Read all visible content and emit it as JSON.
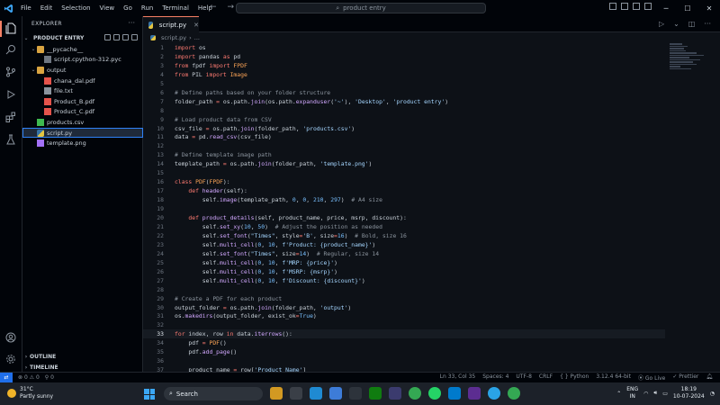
{
  "menu": [
    "File",
    "Edit",
    "Selection",
    "View",
    "Go",
    "Run",
    "Terminal",
    "Help"
  ],
  "search": {
    "placeholder": "product entry"
  },
  "explorer": {
    "header": "EXPLORER",
    "folder_title": "PRODUCT ENTRY",
    "tree": [
      {
        "label": "__pycache__",
        "depth": 1,
        "kind": "folder",
        "open": true
      },
      {
        "label": "script.cpython-312.pyc",
        "depth": 2,
        "kind": "pyc"
      },
      {
        "label": "output",
        "depth": 1,
        "kind": "folder",
        "open": true
      },
      {
        "label": "chana_dal.pdf",
        "depth": 2,
        "kind": "pdf"
      },
      {
        "label": "file.txt",
        "depth": 2,
        "kind": "txt"
      },
      {
        "label": "Product_B.pdf",
        "depth": 2,
        "kind": "pdf"
      },
      {
        "label": "Product_C.pdf",
        "depth": 2,
        "kind": "pdf"
      },
      {
        "label": "products.csv",
        "depth": 1,
        "kind": "csv"
      },
      {
        "label": "script.py",
        "depth": 1,
        "kind": "py",
        "selected": true
      },
      {
        "label": "template.png",
        "depth": 1,
        "kind": "png"
      }
    ],
    "outline": "OUTLINE",
    "timeline": "TIMELINE"
  },
  "editor": {
    "tab_label": "script.py",
    "breadcrumb": [
      "script.py",
      "..."
    ],
    "current_line": 33,
    "lines": [
      [
        [
          "kw",
          "import"
        ],
        [
          "id",
          " os"
        ]
      ],
      [
        [
          "kw",
          "import"
        ],
        [
          "id",
          " pandas "
        ],
        [
          "kw",
          "as"
        ],
        [
          "id",
          " pd"
        ]
      ],
      [
        [
          "kw",
          "from"
        ],
        [
          "id",
          " fpdf "
        ],
        [
          "kw",
          "import"
        ],
        [
          "cl",
          " FPDF"
        ]
      ],
      [
        [
          "kw",
          "from"
        ],
        [
          "id",
          " PIL "
        ],
        [
          "kw",
          "import"
        ],
        [
          "cl",
          " Image"
        ]
      ],
      [],
      [
        [
          "cm",
          "# Define paths based on your folder structure"
        ]
      ],
      [
        [
          "id",
          "folder_path "
        ],
        [
          "op",
          "="
        ],
        [
          "id",
          " os.path."
        ],
        [
          "fn",
          "join"
        ],
        [
          "id",
          "(os.path."
        ],
        [
          "fn",
          "expanduser"
        ],
        [
          "id",
          "("
        ],
        [
          "st",
          "'~'"
        ],
        [
          "id",
          "), "
        ],
        [
          "st",
          "'Desktop'"
        ],
        [
          "id",
          ", "
        ],
        [
          "st",
          "'product entry'"
        ],
        [
          "id",
          ")"
        ]
      ],
      [],
      [
        [
          "cm",
          "# Load product data from CSV"
        ]
      ],
      [
        [
          "id",
          "csv_file "
        ],
        [
          "op",
          "="
        ],
        [
          "id",
          " os.path."
        ],
        [
          "fn",
          "join"
        ],
        [
          "id",
          "(folder_path, "
        ],
        [
          "st",
          "'products.csv'"
        ],
        [
          "id",
          ")"
        ]
      ],
      [
        [
          "id",
          "data "
        ],
        [
          "op",
          "="
        ],
        [
          "id",
          " pd."
        ],
        [
          "fn",
          "read_csv"
        ],
        [
          "id",
          "(csv_file)"
        ]
      ],
      [],
      [
        [
          "cm",
          "# Define template image path"
        ]
      ],
      [
        [
          "id",
          "template_path "
        ],
        [
          "op",
          "="
        ],
        [
          "id",
          " os.path."
        ],
        [
          "fn",
          "join"
        ],
        [
          "id",
          "(folder_path, "
        ],
        [
          "st",
          "'template.png'"
        ],
        [
          "id",
          ")"
        ]
      ],
      [],
      [
        [
          "kw",
          "class"
        ],
        [
          "cl",
          " PDF"
        ],
        [
          "id",
          "("
        ],
        [
          "cl",
          "FPDF"
        ],
        [
          "id",
          "):"
        ]
      ],
      [
        [
          "id",
          "    "
        ],
        [
          "kw",
          "def"
        ],
        [
          "fn",
          " header"
        ],
        [
          "id",
          "(self):"
        ]
      ],
      [
        [
          "id",
          "        self."
        ],
        [
          "fn",
          "image"
        ],
        [
          "id",
          "(template_path, "
        ],
        [
          "nm",
          "0"
        ],
        [
          "id",
          ", "
        ],
        [
          "nm",
          "0"
        ],
        [
          "id",
          ", "
        ],
        [
          "nm",
          "210"
        ],
        [
          "id",
          ", "
        ],
        [
          "nm",
          "297"
        ],
        [
          "id",
          ")  "
        ],
        [
          "cm",
          "# A4 size"
        ]
      ],
      [],
      [
        [
          "id",
          "    "
        ],
        [
          "kw",
          "def"
        ],
        [
          "fn",
          " product_details"
        ],
        [
          "id",
          "(self, product_name, price, msrp, discount):"
        ]
      ],
      [
        [
          "id",
          "        self."
        ],
        [
          "fn",
          "set_xy"
        ],
        [
          "id",
          "("
        ],
        [
          "nm",
          "10"
        ],
        [
          "id",
          ", "
        ],
        [
          "nm",
          "50"
        ],
        [
          "id",
          ")  "
        ],
        [
          "cm",
          "# Adjust the position as needed"
        ]
      ],
      [
        [
          "id",
          "        self."
        ],
        [
          "fn",
          "set_font"
        ],
        [
          "id",
          "("
        ],
        [
          "st",
          "\"Times\""
        ],
        [
          "id",
          ", style"
        ],
        [
          "op",
          "="
        ],
        [
          "st",
          "'B'"
        ],
        [
          "id",
          ", size"
        ],
        [
          "op",
          "="
        ],
        [
          "nm",
          "16"
        ],
        [
          "id",
          ")  "
        ],
        [
          "cm",
          "# Bold, size 16"
        ]
      ],
      [
        [
          "id",
          "        self."
        ],
        [
          "fn",
          "multi_cell"
        ],
        [
          "id",
          "("
        ],
        [
          "nm",
          "0"
        ],
        [
          "id",
          ", "
        ],
        [
          "nm",
          "10"
        ],
        [
          "id",
          ", "
        ],
        [
          "st",
          "f'Product: {product_name}'"
        ],
        [
          "id",
          ")"
        ]
      ],
      [
        [
          "id",
          "        self."
        ],
        [
          "fn",
          "set_font"
        ],
        [
          "id",
          "("
        ],
        [
          "st",
          "\"Times\""
        ],
        [
          "id",
          ", size"
        ],
        [
          "op",
          "="
        ],
        [
          "nm",
          "14"
        ],
        [
          "id",
          ")  "
        ],
        [
          "cm",
          "# Regular, size 14"
        ]
      ],
      [
        [
          "id",
          "        self."
        ],
        [
          "fn",
          "multi_cell"
        ],
        [
          "id",
          "("
        ],
        [
          "nm",
          "0"
        ],
        [
          "id",
          ", "
        ],
        [
          "nm",
          "10"
        ],
        [
          "id",
          ", "
        ],
        [
          "st",
          "f'MRP: {price}'"
        ],
        [
          "id",
          ")"
        ]
      ],
      [
        [
          "id",
          "        self."
        ],
        [
          "fn",
          "multi_cell"
        ],
        [
          "id",
          "("
        ],
        [
          "nm",
          "0"
        ],
        [
          "id",
          ", "
        ],
        [
          "nm",
          "10"
        ],
        [
          "id",
          ", "
        ],
        [
          "st",
          "f'MSRP: {msrp}'"
        ],
        [
          "id",
          ")"
        ]
      ],
      [
        [
          "id",
          "        self."
        ],
        [
          "fn",
          "multi_cell"
        ],
        [
          "id",
          "("
        ],
        [
          "nm",
          "0"
        ],
        [
          "id",
          ", "
        ],
        [
          "nm",
          "10"
        ],
        [
          "id",
          ", "
        ],
        [
          "st",
          "f'Discount: {discount}'"
        ],
        [
          "id",
          ")"
        ]
      ],
      [],
      [
        [
          "cm",
          "# Create a PDF for each product"
        ]
      ],
      [
        [
          "id",
          "output_folder "
        ],
        [
          "op",
          "="
        ],
        [
          "id",
          " os.path."
        ],
        [
          "fn",
          "join"
        ],
        [
          "id",
          "(folder_path, "
        ],
        [
          "st",
          "'output'"
        ],
        [
          "id",
          ")"
        ]
      ],
      [
        [
          "id",
          "os."
        ],
        [
          "fn",
          "makedirs"
        ],
        [
          "id",
          "(output_folder, exist_ok"
        ],
        [
          "op",
          "="
        ],
        [
          "nm",
          "True"
        ],
        [
          "id",
          ")"
        ]
      ],
      [],
      [
        [
          "kw",
          "for"
        ],
        [
          "id",
          " index, row "
        ],
        [
          "kw",
          "in"
        ],
        [
          "id",
          " data."
        ],
        [
          "fn",
          "iterrows"
        ],
        [
          "id",
          "():"
        ]
      ],
      [
        [
          "id",
          "    pdf "
        ],
        [
          "op",
          "="
        ],
        [
          "cl",
          " PDF"
        ],
        [
          "id",
          "()"
        ]
      ],
      [
        [
          "id",
          "    pdf."
        ],
        [
          "fn",
          "add_page"
        ],
        [
          "id",
          "()"
        ]
      ],
      [],
      [
        [
          "id",
          "    product_name "
        ],
        [
          "op",
          "="
        ],
        [
          "id",
          " row["
        ],
        [
          "st",
          "'Product Name'"
        ],
        [
          "id",
          "]"
        ]
      ]
    ]
  },
  "status": {
    "errors": "0",
    "warnings": "0",
    "ports": "0",
    "position": "Ln 33, Col 35",
    "spaces": "Spaces: 4",
    "encoding": "UTF-8",
    "eol": "CRLF",
    "language": "Python",
    "interpreter": "3.12.4 64-bit",
    "golive": "Go Live",
    "prettier": "Prettier"
  },
  "taskbar": {
    "temp": "31°C",
    "weather": "Partly sunny",
    "search_label": "Search",
    "lang_top": "ENG",
    "lang_bottom": "IN",
    "time": "18:19",
    "date": "10-07-2024"
  }
}
